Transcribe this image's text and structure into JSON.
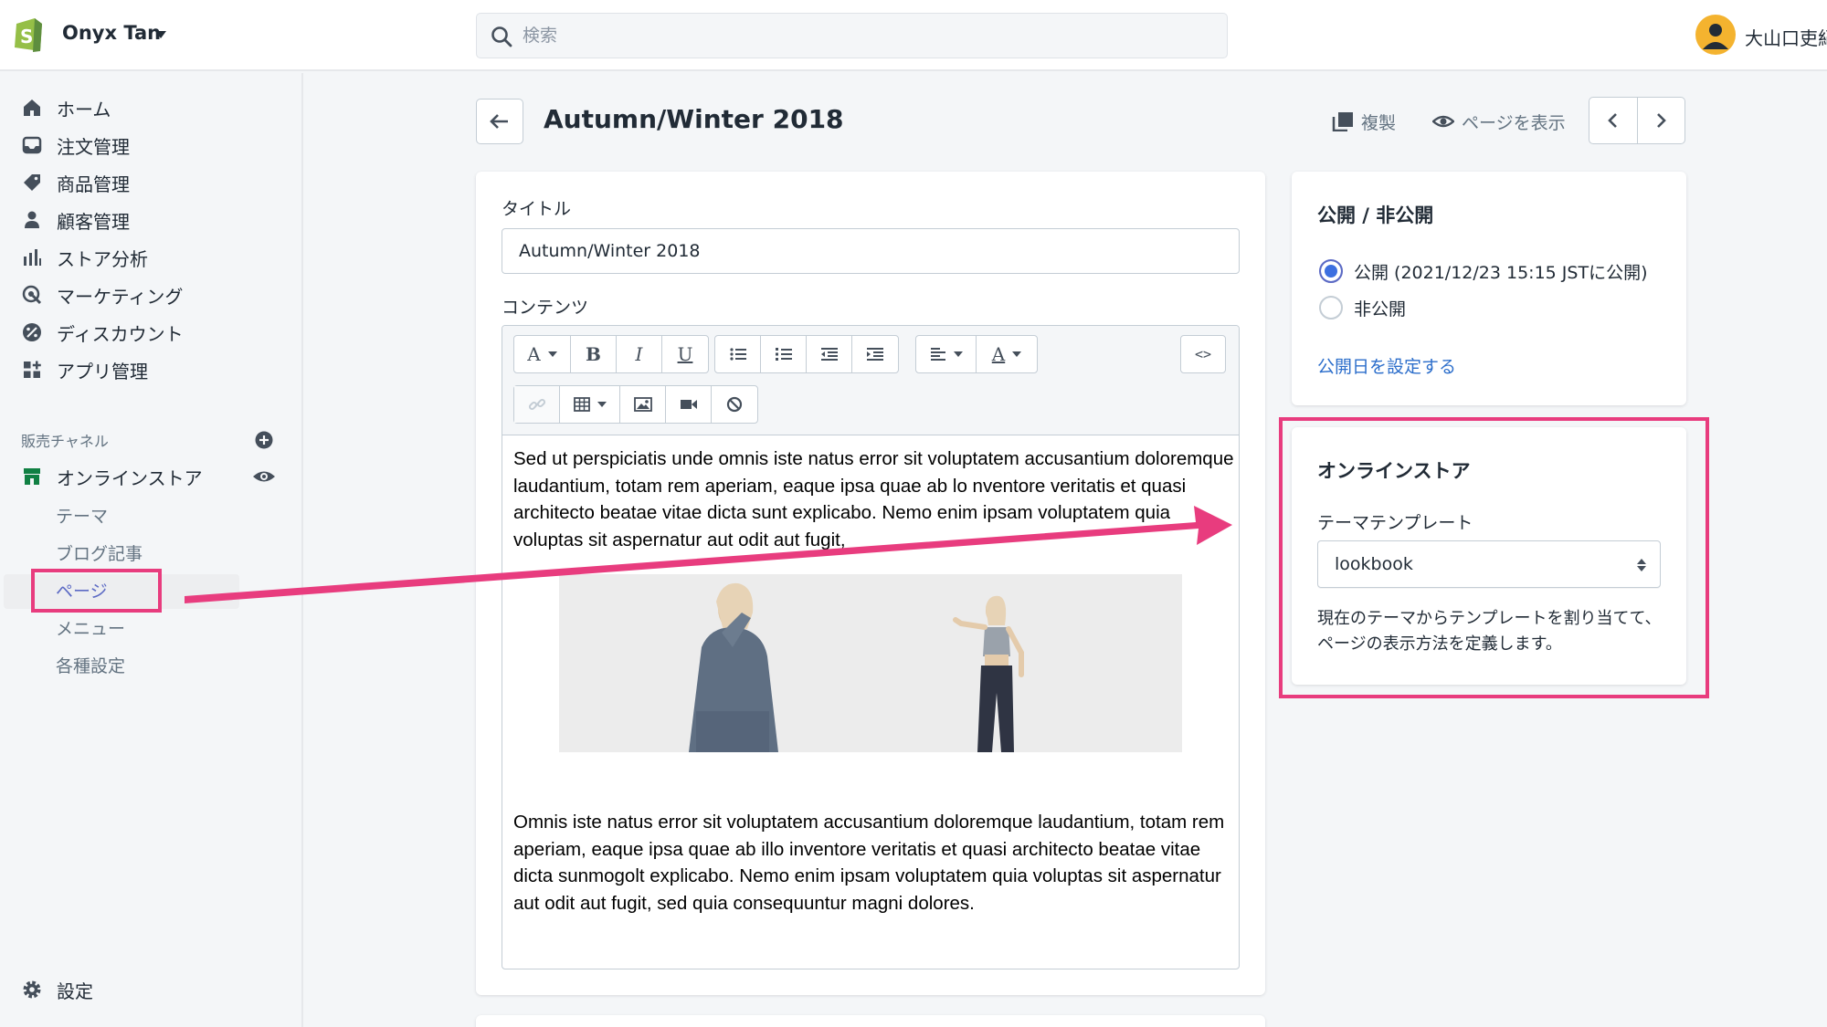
{
  "topbar": {
    "store_name": "Onyx Tan",
    "search_placeholder": "検索",
    "user_name": "大山口吏紀"
  },
  "sidebar": {
    "items": [
      {
        "label": "ホーム",
        "icon": "home-icon"
      },
      {
        "label": "注文管理",
        "icon": "inbox-icon"
      },
      {
        "label": "商品管理",
        "icon": "tag-icon"
      },
      {
        "label": "顧客管理",
        "icon": "person-icon"
      },
      {
        "label": "ストア分析",
        "icon": "bar-chart-icon"
      },
      {
        "label": "マーケティング",
        "icon": "target-icon"
      },
      {
        "label": "ディスカウント",
        "icon": "discount-icon"
      },
      {
        "label": "アプリ管理",
        "icon": "apps-icon"
      }
    ],
    "channels_label": "販売チャネル",
    "online_store": "オンラインストア",
    "sub_items": [
      "テーマ",
      "ブログ記事",
      "ページ",
      "メニュー",
      "各種設定"
    ],
    "settings": "設定"
  },
  "header": {
    "title": "Autumn/Winter 2018",
    "duplicate": "複製",
    "view_page": "ページを表示"
  },
  "main": {
    "title_label": "タイトル",
    "title_value": "Autumn/Winter 2018",
    "content_label": "コンテンツ",
    "paragraph1": "Sed ut perspiciatis unde omnis iste natus error sit voluptatem accusantium doloremque laudantium, totam rem aperiam, eaque ipsa quae ab lo nventore veritatis et quasi architecto beatae vitae dicta sunt explicabo. Nemo enim ipsam voluptatem quia voluptas sit aspernatur aut odit aut fugit,",
    "paragraph2": "Omnis iste natus error sit voluptatem accusantium doloremque laudantium, totam rem aperiam, eaque ipsa quae ab illo inventore veritatis et quasi architecto beatae vitae dicta sunmogolt explicabo. Nemo enim ipsam voluptatem quia voluptas sit aspernatur aut odit aut fugit, sed quia consequuntur magni dolores."
  },
  "visibility": {
    "title": "公開 / 非公開",
    "published": "公開 (2021/12/23 15:15 JSTに公開)",
    "hidden": "非公開",
    "set_date": "公開日を設定する",
    "selected": "published"
  },
  "online_store_card": {
    "title": "オンラインストア",
    "template_label": "テーマテンプレート",
    "template_value": "lookbook",
    "help": "現在のテーマからテンプレートを割り当てて、ページの表示方法を定義します。"
  },
  "colors": {
    "accent": "#5c6ac4",
    "link": "#2c6ecb",
    "annotation": "#e83c7e",
    "brand_green": "#95bf47"
  }
}
